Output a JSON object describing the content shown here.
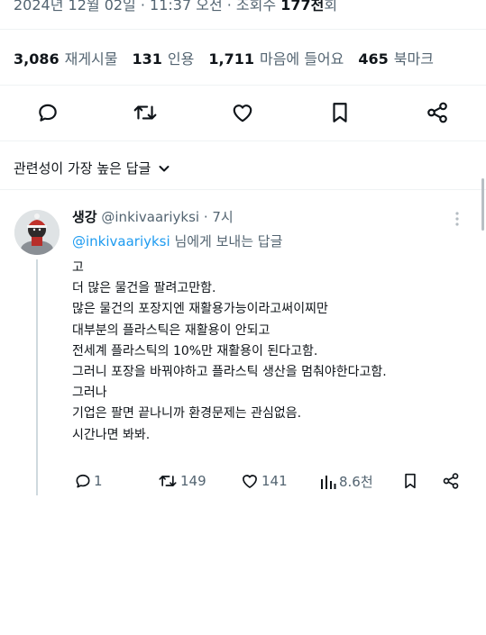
{
  "tweet_meta": {
    "date_time": "2024년 12월 02일 · 11:37 오전 · 조회수",
    "views": "177천",
    "views_suffix": "회"
  },
  "stats": [
    {
      "count": "3,086",
      "label": "재게시물"
    },
    {
      "count": "131",
      "label": "인용"
    },
    {
      "count": "1,711",
      "label": "마음에 들어요"
    },
    {
      "count": "465",
      "label": "북마크"
    }
  ],
  "action_icons": [
    "reply-icon",
    "retweet-icon",
    "like-icon",
    "bookmark-icon",
    "share-icon"
  ],
  "sort": {
    "label": "관련성이 가장 높은 답글"
  },
  "reply": {
    "name": "생강",
    "handle": "@inkivaariyksi",
    "time": "· 7시",
    "replying_mention": "@inkivaariyksi",
    "replying_suffix": " 님에게 보내는 답글",
    "lines": [
      "고",
      "더 많은 물건을 팔려고만함.",
      "많은 물건의 포장지엔 재활용가능이라고써이찌만",
      "대부분의 플라스틱은 재활용이 안되고",
      "전세계 플라스틱의 10%만 재활용이 된다고함.",
      "그러니 포장을 바꿔야하고 플라스틱 생산을 멈춰야한다고함.",
      "그러나",
      "기업은 팔면 끝나니까 환경문제는 관심없음.",
      "시간나면 봐봐."
    ],
    "actions": {
      "replies": "1",
      "retweets": "149",
      "likes": "141",
      "views": "8.6천"
    }
  },
  "colors": {
    "text": "#0f1419",
    "muted": "#536471",
    "accent": "#1d9bf0",
    "border": "#eff3f4"
  }
}
